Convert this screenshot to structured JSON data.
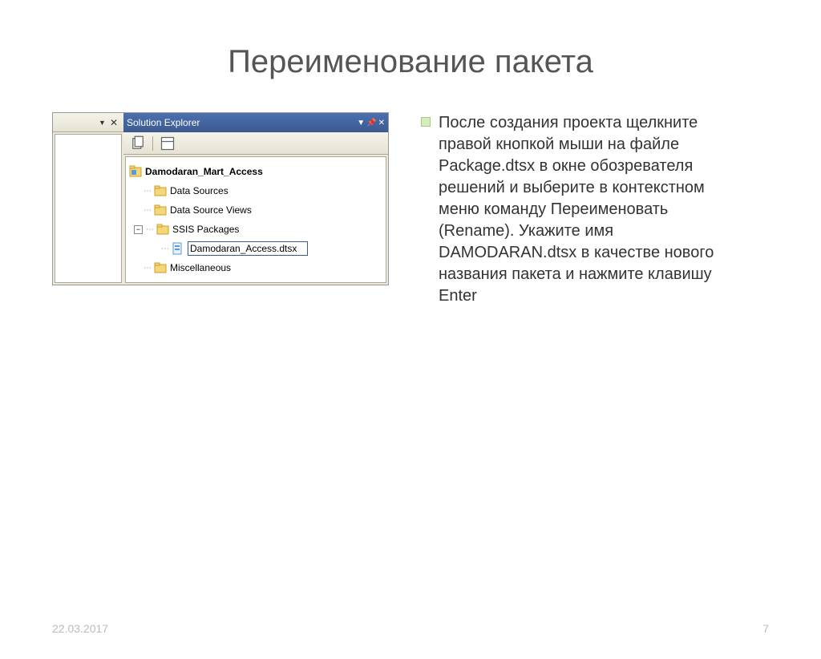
{
  "title": "Переименование пакета",
  "screenshot": {
    "se_title": "Solution Explorer",
    "project_name": "Damodaran_Mart_Access",
    "folders": {
      "data_sources": "Data Sources",
      "data_source_views": "Data Source Views",
      "ssis_packages": "SSIS Packages",
      "miscellaneous": "Miscellaneous"
    },
    "rename_value": "Damodaran_Access.dtsx"
  },
  "body_text": "После создания проекта щелкните правой кнопкой мыши на файле Package.dtsx в окне обозревателя решений и выберите в контекстном меню команду Переименовать (Rename). Укажите имя DAMODARAN.dtsx в качестве нового названия пакета и нажмите клавишу Enter",
  "footer": {
    "date": "22.03.2017",
    "page": "7"
  }
}
